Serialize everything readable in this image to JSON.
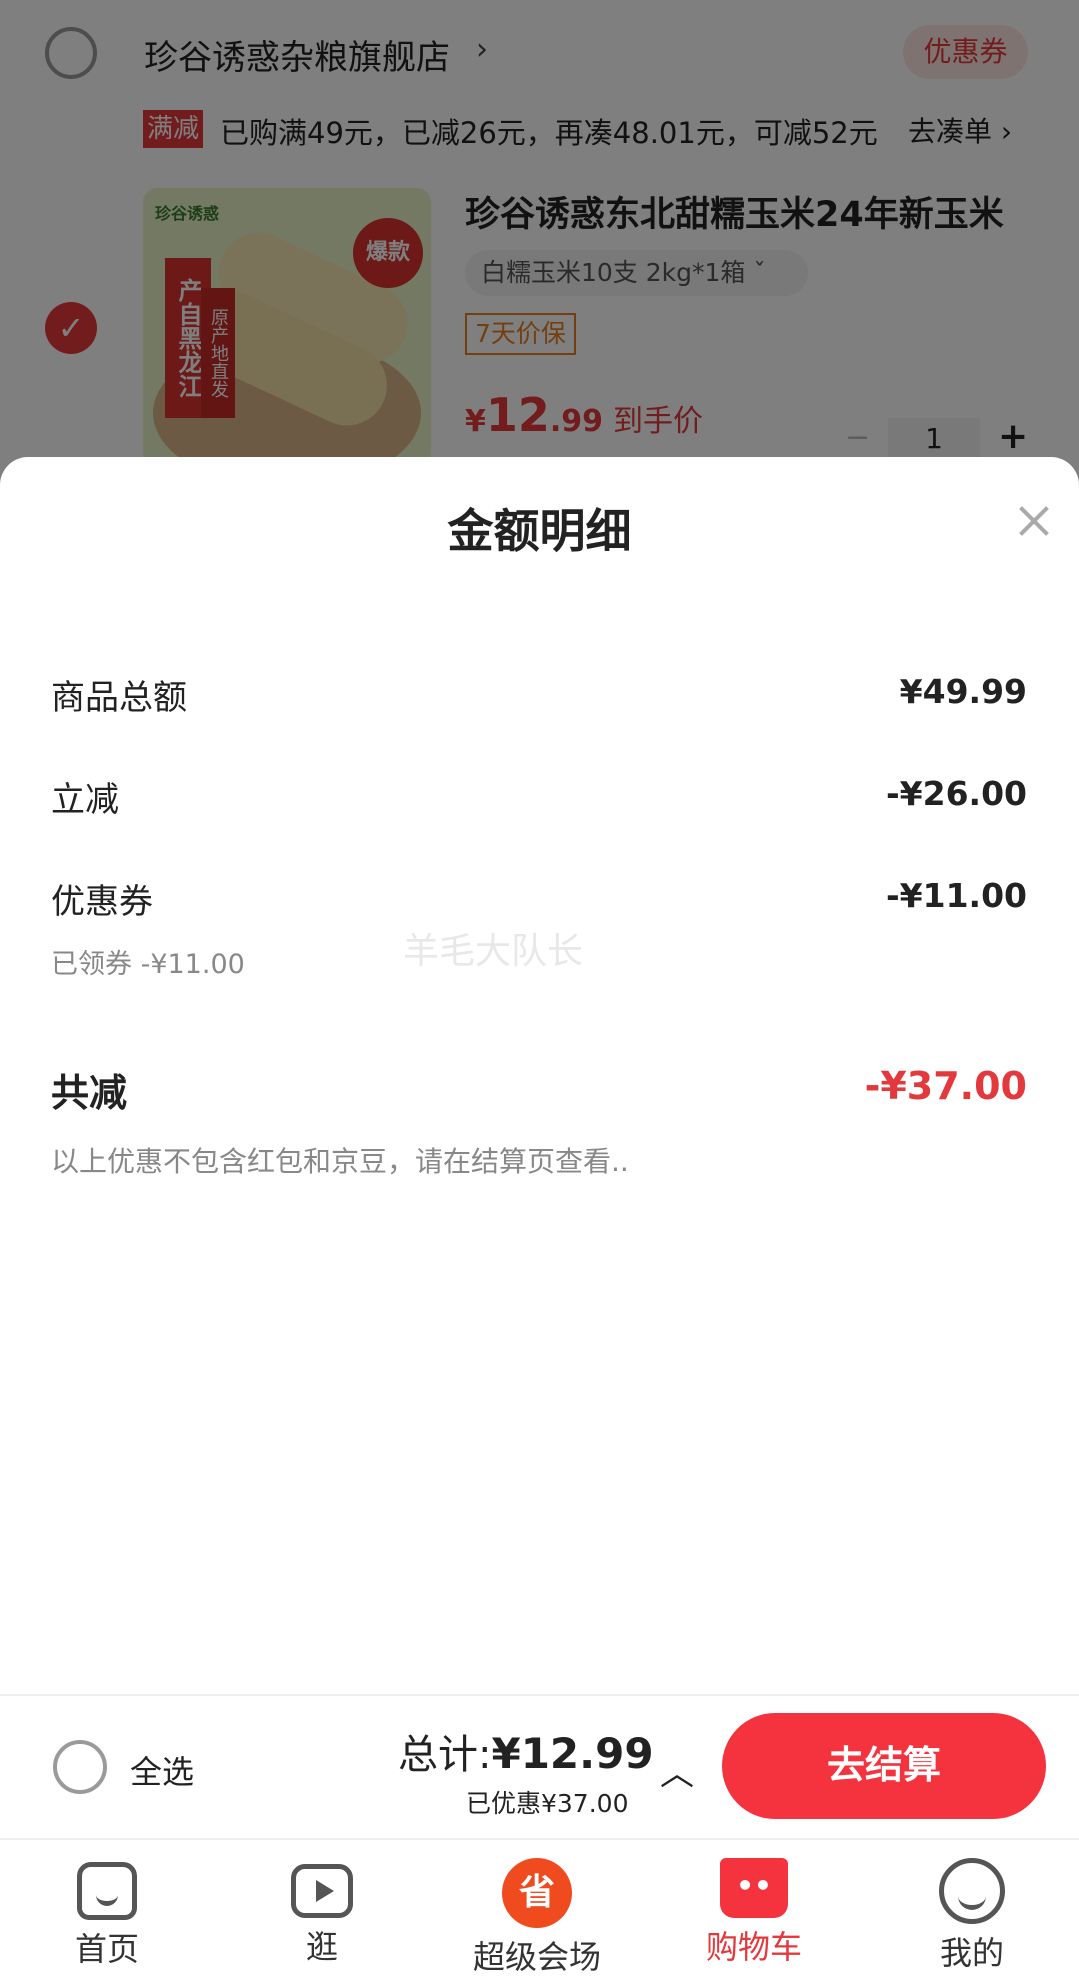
{
  "store": {
    "name": "珍谷诱惑杂粮旗舰店",
    "chevron": "›",
    "coupon_tag": "优惠券",
    "promo_badge": "满减",
    "promo_text": "已购满49元，已减26元，再凑48.01元，可减52元",
    "promo_link": "去凑单 ›"
  },
  "product": {
    "checked_mark": "✓",
    "image_brand": "珍谷诱惑",
    "image_ribbon": "产自黑龙江",
    "image_ribbon2": "原产地直发",
    "image_hot": "爆款",
    "title": "珍谷诱惑东北甜糯玉米24年新玉米",
    "sku": "白糯玉米10支 2kg*1箱  ˇ",
    "price_guard": "7天价保",
    "price_currency": "¥",
    "price_int": "12",
    "price_dec": ".99",
    "price_label": "到手价",
    "qty_minus": "−",
    "qty_value": "1",
    "qty_plus": "+"
  },
  "sheet": {
    "title": "金额明细",
    "rows": [
      {
        "label": "商品总额",
        "value": "¥49.99"
      },
      {
        "label": "立减",
        "value": "-¥26.00"
      },
      {
        "label": "优惠券",
        "value": "-¥11.00",
        "sub": "已领券 -¥11.00"
      }
    ],
    "watermark": "羊毛大队长",
    "total_label": "共减",
    "total_value": "-¥37.00",
    "note": "以上优惠不包含红包和京豆，请在结算页查看.."
  },
  "checkout": {
    "select_all": "全选",
    "sum_prefix": "总计:",
    "sum_value": "¥12.99",
    "saved": "已优惠¥37.00",
    "expand": "︿",
    "button": "去结算"
  },
  "tabs": [
    {
      "label": "首页",
      "icon": "home-icon"
    },
    {
      "label": "逛",
      "icon": "video-icon"
    },
    {
      "label": "超级会场",
      "icon": "super-venue-icon",
      "glyph": "省"
    },
    {
      "label": "购物车",
      "icon": "cart-icon",
      "glyph": "••",
      "active": true
    },
    {
      "label": "我的",
      "icon": "profile-icon"
    }
  ],
  "colors": {
    "accent": "#e4393c",
    "checkout_button": "#f5333f",
    "muted_text": "#888888"
  }
}
